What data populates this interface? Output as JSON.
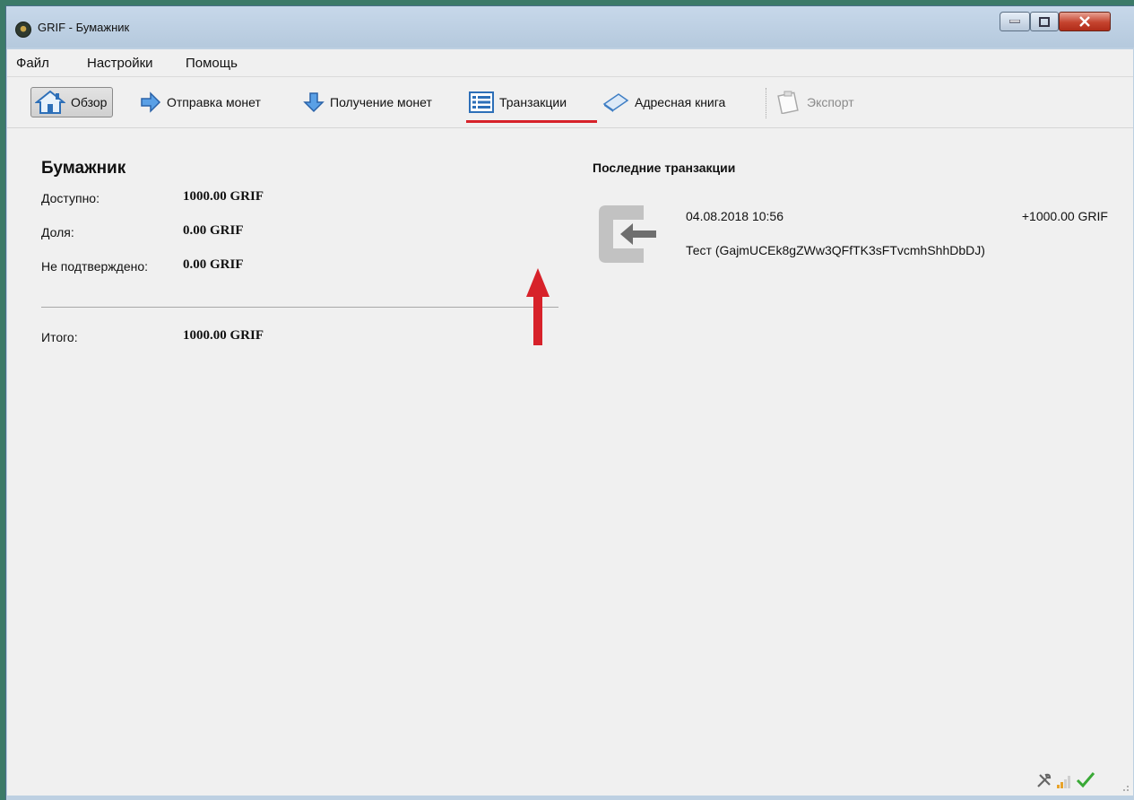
{
  "window": {
    "title": "GRIF - Бумажник"
  },
  "menu": [
    {
      "label": "Файл"
    },
    {
      "label": "Настройки"
    },
    {
      "label": "Помощь"
    }
  ],
  "toolbar": {
    "overview": "Обзор",
    "send": "Отправка монет",
    "receive": "Получение монет",
    "transactions": "Транзакции",
    "addressbook": "Адресная книга",
    "export": "Экспорт"
  },
  "wallet": {
    "title": "Бумажник",
    "rows": [
      {
        "label": "Доступно:",
        "value": "1000.00 GRIF"
      },
      {
        "label": "Доля:",
        "value": "0.00 GRIF"
      },
      {
        "label": "Не подтверждено:",
        "value": "0.00 GRIF"
      }
    ],
    "total": {
      "label": "Итого:",
      "value": "1000.00 GRIF"
    }
  },
  "recent": {
    "title": "Последние транзакции",
    "transactions": [
      {
        "date": "04.08.2018 10:56",
        "amount": "+1000.00 GRIF",
        "description": "Тест (GajmUCEk8gZWw3QFfTK3sFTvcmhShhDbDJ)"
      }
    ]
  },
  "colors": {
    "annotation": "#d7222a",
    "background": "#f0f0f0"
  },
  "icons": {
    "overview": "home-icon",
    "send": "arrow-right-icon",
    "receive": "arrow-down-icon",
    "transactions": "list-icon",
    "addressbook": "address-book-icon",
    "export": "clipboard-icon",
    "tx": "incoming-transaction-icon",
    "status": [
      "tools-icon",
      "signal-bars-icon",
      "checkmark-icon"
    ]
  }
}
